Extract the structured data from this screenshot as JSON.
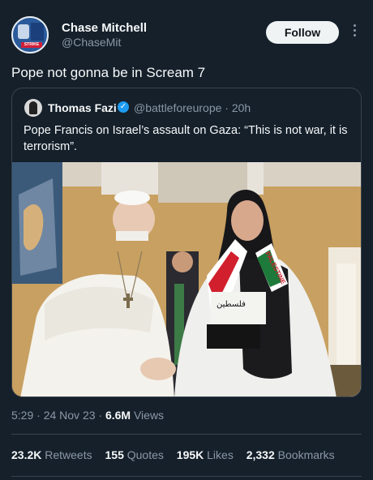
{
  "author": {
    "name": "Chase Mitchell",
    "handle": "@ChaseMit",
    "avatar_label": "STRIKE"
  },
  "follow_label": "Follow",
  "tweet_text": "Pope not gonna be in Scream 7",
  "quoted": {
    "name": "Thomas Fazi",
    "handle": "@battleforeurope",
    "time": "· 20h",
    "text": "Pope Francis on Israel’s assault on Gaza: “This is not war, it is terrorism”.",
    "scarf_text": "PALESTINE",
    "scarf_arabic": "فلسطين"
  },
  "meta": {
    "time": "5:29 · 24 Nov 23 ·",
    "views_count": "6.6M",
    "views_label": "Views"
  },
  "stats": {
    "retweets_count": "23.2K",
    "retweets_label": "Retweets",
    "quotes_count": "155",
    "quotes_label": "Quotes",
    "likes_count": "195K",
    "likes_label": "Likes",
    "bookmarks_count": "2,332",
    "bookmarks_label": "Bookmarks"
  },
  "colors": {
    "background": "#15202b",
    "text": "#f7f9f9",
    "muted": "#8b98a5",
    "border": "#38444d",
    "verified": "#1d9bf0"
  }
}
